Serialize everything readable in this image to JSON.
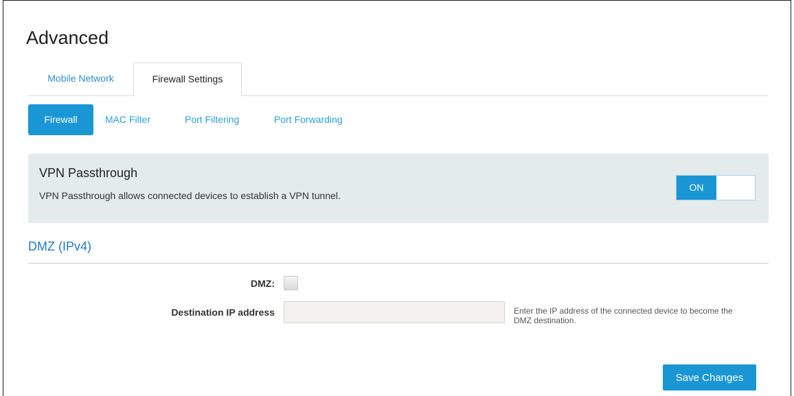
{
  "page": {
    "title": "Advanced"
  },
  "main_tabs": [
    {
      "label": "Mobile Network",
      "active": false
    },
    {
      "label": "Firewall Settings",
      "active": true
    }
  ],
  "sub_tabs": [
    {
      "label": "Firewall",
      "active": true
    },
    {
      "label": "MAC Filter",
      "active": false
    },
    {
      "label": "Port Filtering",
      "active": false
    },
    {
      "label": "Port Forwarding",
      "active": false
    }
  ],
  "vpn": {
    "title": "VPN Passthrough",
    "description": "VPN Passthrough allows connected devices to establish a VPN tunnel.",
    "toggle_label": "ON",
    "enabled": true
  },
  "dmz": {
    "section_title": "DMZ (IPv4)",
    "dmz_label": "DMZ:",
    "dmz_checked": false,
    "dest_ip_label": "Destination IP address",
    "dest_ip_value": "",
    "help_text": "Enter the IP address of the connected device to become the DMZ destination."
  },
  "actions": {
    "save_label": "Save Changes"
  },
  "colors": {
    "accent": "#1a96d4",
    "link": "#2a9fd8",
    "section_title": "#2277c4",
    "panel_bg": "#e4ebeb"
  }
}
